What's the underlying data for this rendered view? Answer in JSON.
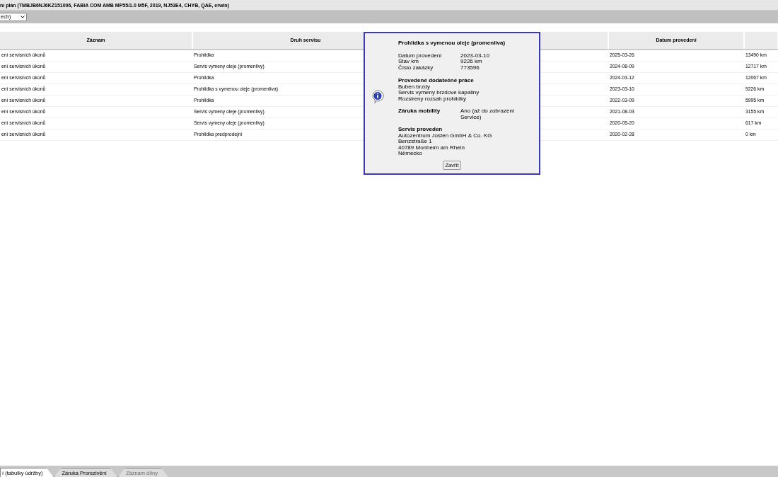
{
  "title": "ní plán (TMBJB6NJ6KZ151006, FABIA COM AMB MP55/1.0 M5F, 2019, NJ53E4, CHYB, QAE, erwin)",
  "filter": {
    "value": "ech)"
  },
  "table": {
    "columns": [
      "Záznam",
      "Druh servisu",
      "",
      "Datum provedení",
      ""
    ],
    "rows": [
      {
        "record": "ení servisních úkonů",
        "service": "Prohlidka",
        "date": "2025-03-26",
        "km": "13490 km"
      },
      {
        "record": "ení servisních úkonů",
        "service": "Servis vymeny oleje (promenlivy)",
        "date": "2024-08-09",
        "km": "12717 km"
      },
      {
        "record": "ení servisních úkonů",
        "service": "Prohlidka",
        "date": "2024-03-12",
        "km": "12067 km"
      },
      {
        "record": "ení servisních úkonů",
        "service": "Prohlidka s vymenou oleje (promenliva)",
        "date": "2023-03-10",
        "km": "9226 km"
      },
      {
        "record": "ení servisních úkonů",
        "service": "Prohlidka",
        "date": "2022-03-09",
        "km": "5995 km"
      },
      {
        "record": "ení servisních úkonů",
        "service": "Servis vymeny oleje (promenlivy)",
        "date": "2021-08-03",
        "km": "3155 km"
      },
      {
        "record": "ení servisních úkonů",
        "service": "Servis vymeny oleje (promenlivy)",
        "date": "2020-05-20",
        "km": "617 km"
      },
      {
        "record": "ení servisních úkonů",
        "service": "Prohlidka predprodejni",
        "date": "2020-02-28",
        "km": "0 km"
      }
    ]
  },
  "dialog": {
    "title": "Prohlidka s vymenou oleje (promenliva)",
    "facts": [
      {
        "label": "Datum provedeni",
        "value": "2023-03-10"
      },
      {
        "label": "Stav km",
        "value": "9226 km"
      },
      {
        "label": "Číslo zakázky",
        "value": "773596"
      }
    ],
    "extra_heading": "Provedené dodatečné práce",
    "extra_items": [
      "Buben brzdy",
      "Servis vymeny brzdove kapaliny",
      "Rozsireny rozsah prohlidky"
    ],
    "warranty_label": "Záruka mobility",
    "warranty_value": "Ano (až do zobrazení Service)",
    "dealer_heading": "Servis proveden",
    "dealer_lines": [
      "Autozentrum Josten GmbH & Co. KG",
      "Benzstraße 1",
      "40789 Monheim am Rhein",
      "Německo"
    ],
    "close": "Zavřít"
  },
  "tabs": [
    {
      "label": "í (tabulky údržby)",
      "selected": true,
      "disabled": false
    },
    {
      "label": "Záruka Prorezivění",
      "selected": false,
      "disabled": false
    },
    {
      "label": "Záznam dílny",
      "selected": false,
      "disabled": true
    }
  ]
}
